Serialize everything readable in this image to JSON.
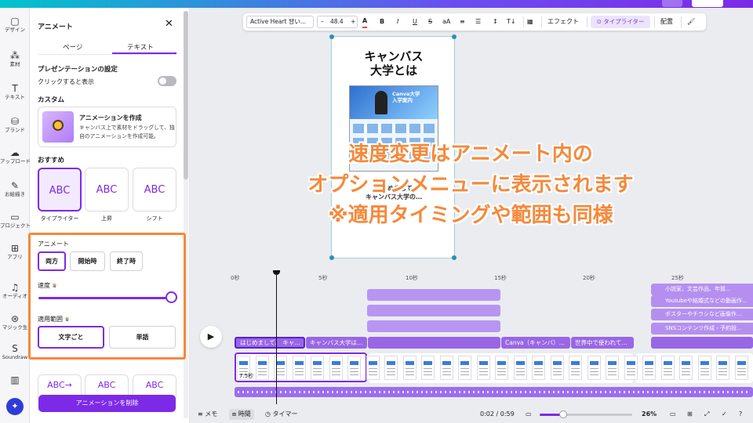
{
  "rail": {
    "items": [
      {
        "icon": "▢",
        "label": "デザイン"
      },
      {
        "icon": "⁂",
        "label": "素材"
      },
      {
        "icon": "T",
        "label": "テキスト"
      },
      {
        "icon": "⛁",
        "label": "ブランド"
      },
      {
        "icon": "☁",
        "label": "アップロード"
      },
      {
        "icon": "✎",
        "label": "お絵描き"
      },
      {
        "icon": "▭",
        "label": "プロジェクト"
      },
      {
        "icon": "⊞",
        "label": "アプリ"
      },
      {
        "icon": "♫",
        "label": "オーディオ"
      },
      {
        "icon": "⊛",
        "label": "マジック生"
      },
      {
        "icon": "S",
        "label": "Soundraw"
      },
      {
        "icon": "▥",
        "label": ""
      }
    ],
    "magic_icon": "✦"
  },
  "panel": {
    "title": "アニメート",
    "close": "✕",
    "tabs": [
      "ページ",
      "テキスト"
    ],
    "presentation_heading": "プレゼンテーションの設定",
    "click_to_show": "クリックすると表示",
    "custom_heading": "カスタム",
    "create_title": "アニメーションを作成",
    "create_desc": "キャンバス上で素材をドラッグして、独自のアニメーションを作成可能。",
    "recommended_heading": "おすすめ",
    "tiles": [
      {
        "glyph": "ABC",
        "label": "タイプライター"
      },
      {
        "glyph": "ABC",
        "label": "上昇"
      },
      {
        "glyph": "ABC",
        "label": "シフト"
      }
    ],
    "animate_label": "アニメート",
    "animate_options": [
      "両方",
      "開始時",
      "終了時"
    ],
    "speed_label": "速度",
    "speed_value": 1.0,
    "scope_label": "適用範囲",
    "scope_options": [
      "文字ごと",
      "単語"
    ],
    "remove_button": "アニメーションを削除",
    "more_tiles": [
      "ABC→",
      "ABC",
      "ABC"
    ]
  },
  "toolbar": {
    "font": "Active Heart 甘い...",
    "minus": "–",
    "size": "48.4",
    "plus": "+",
    "color": "A",
    "bold": "B",
    "italic": "I",
    "underline": "U",
    "strike": "S",
    "case": "aA",
    "align": "≡",
    "list": "☰",
    "spacing": "↕",
    "vertical": "T↓",
    "transparency": "▦",
    "effect": "エフェクト",
    "typewriter": "⊙ タイプライター",
    "position": "配置",
    "paint": "🖌"
  },
  "canvas": {
    "title": "キャンバス\n大学とは",
    "banner_text": "Canva大学\n入学案内",
    "footer_text": "はじめまして\nキャンバス大学の…",
    "overlay": "速度変更はアニメート内の\nオプションメニューに表示されます\n※適用タイミングや範囲も同様"
  },
  "timeline": {
    "ruler": [
      "0秒",
      "5秒",
      "10秒",
      "15秒",
      "20秒",
      "25秒"
    ],
    "clips": [
      "はじめまして、 キャ…",
      "キャンバス大学は…",
      "",
      "Canva（キャンバ）…",
      "世界中で使われて…",
      ""
    ],
    "right_clips": [
      "小説家、文芸作品、年賀…",
      "Youtubeや結婚式などの動画作…",
      "ポスターやチラシなど画像作…",
      "SNSコンテンツ作成・予約投…"
    ],
    "duration": "7.5秒",
    "play_icon": "▶"
  },
  "bottombar": {
    "memo": "≡ メモ",
    "time": "⧈ 時間",
    "timer": "◷ タイマー",
    "position": "0:02 / 0:59",
    "zoom": "26%",
    "icons": [
      "▭",
      "⊞",
      "⤢",
      "✓",
      "?"
    ]
  }
}
